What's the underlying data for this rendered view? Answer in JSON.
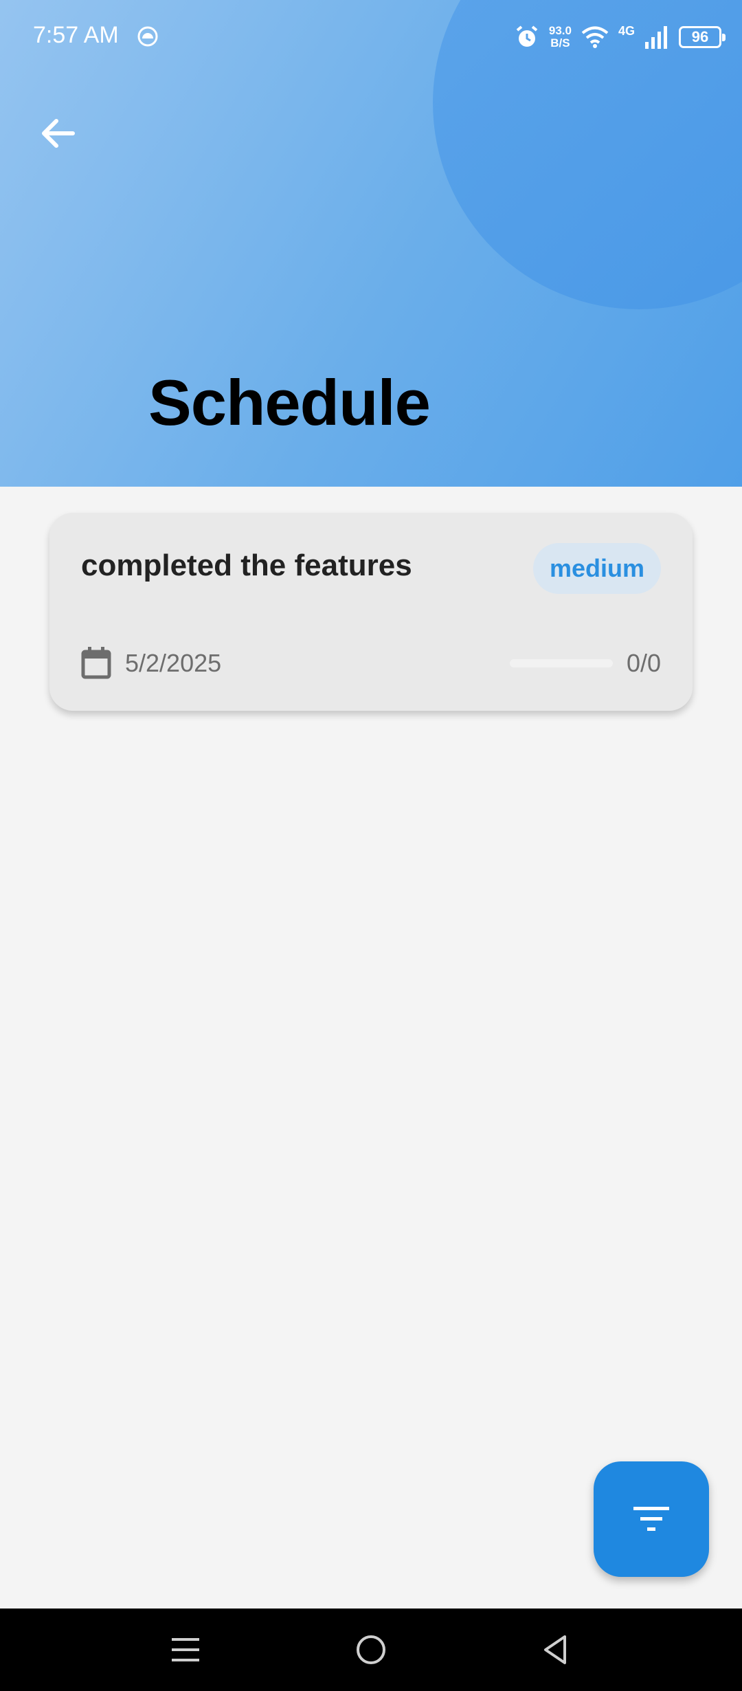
{
  "status_bar": {
    "time": "7:57 AM",
    "speed_value": "93.0",
    "speed_unit": "B/S",
    "network": "4G",
    "battery": "96"
  },
  "header": {
    "title": "Schedule",
    "colors": {
      "gradient_start": "#95c4f0",
      "gradient_end": "#509fe8"
    }
  },
  "tasks": [
    {
      "title": "completed the features",
      "priority": "medium",
      "date": "5/2/2025",
      "progress_text": "0/0",
      "progress_fraction": 0
    }
  ],
  "icons": {
    "back": "arrow-left-icon",
    "calendar": "calendar-icon",
    "filter": "filter-icon",
    "nav_menu": "menu-icon",
    "nav_home": "home-circle-icon",
    "nav_back": "triangle-back-icon"
  },
  "colors": {
    "accent": "#1f88e0",
    "badge_bg": "#d9e6f2",
    "card_bg": "#e9e9e9"
  }
}
